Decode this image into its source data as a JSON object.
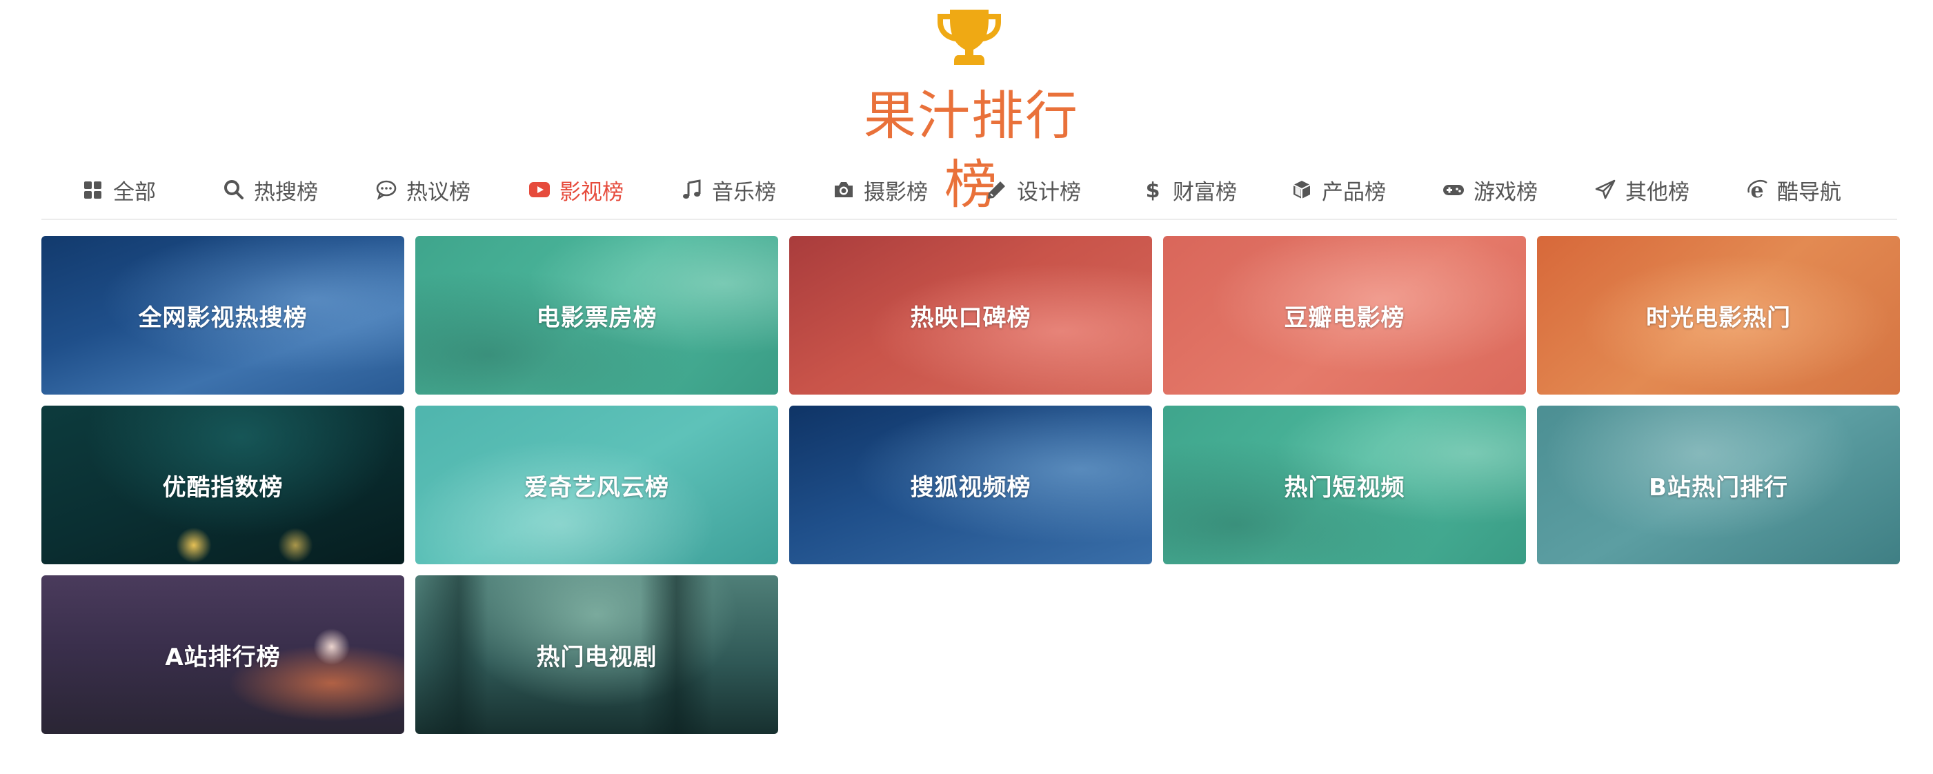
{
  "brand": {
    "title": "果汁排行榜",
    "trophy_icon": "trophy-icon",
    "trophy_color": "#efa914",
    "title_color": "#e9713a"
  },
  "nav": {
    "active_color": "#e64b3c",
    "items": [
      {
        "label": "全部",
        "icon": "grid-icon"
      },
      {
        "label": "热搜榜",
        "icon": "search-icon"
      },
      {
        "label": "热议榜",
        "icon": "comment-icon"
      },
      {
        "label": "影视榜",
        "icon": "video-play-icon",
        "active": true
      },
      {
        "label": "音乐榜",
        "icon": "music-note-icon"
      },
      {
        "label": "摄影榜",
        "icon": "camera-icon"
      },
      {
        "label": "设计榜",
        "icon": "pencil-icon"
      },
      {
        "label": "财富榜",
        "icon": "dollar-icon"
      },
      {
        "label": "产品榜",
        "icon": "cube-icon"
      },
      {
        "label": "游戏榜",
        "icon": "gamepad-icon"
      },
      {
        "label": "其他榜",
        "icon": "paper-plane-icon"
      },
      {
        "label": "酷导航",
        "icon": "browser-e-icon"
      }
    ]
  },
  "cards": [
    {
      "title": "全网影视热搜榜"
    },
    {
      "title": "电影票房榜"
    },
    {
      "title": "热映口碑榜"
    },
    {
      "title": "豆瓣电影榜"
    },
    {
      "title": "时光电影热门"
    },
    {
      "title": "优酷指数榜"
    },
    {
      "title": "爱奇艺风云榜"
    },
    {
      "title": "搜狐视频榜"
    },
    {
      "title": "热门短视频"
    },
    {
      "title": "B站热门排行"
    },
    {
      "title": "A站排行榜"
    },
    {
      "title": "热门电视剧"
    }
  ]
}
